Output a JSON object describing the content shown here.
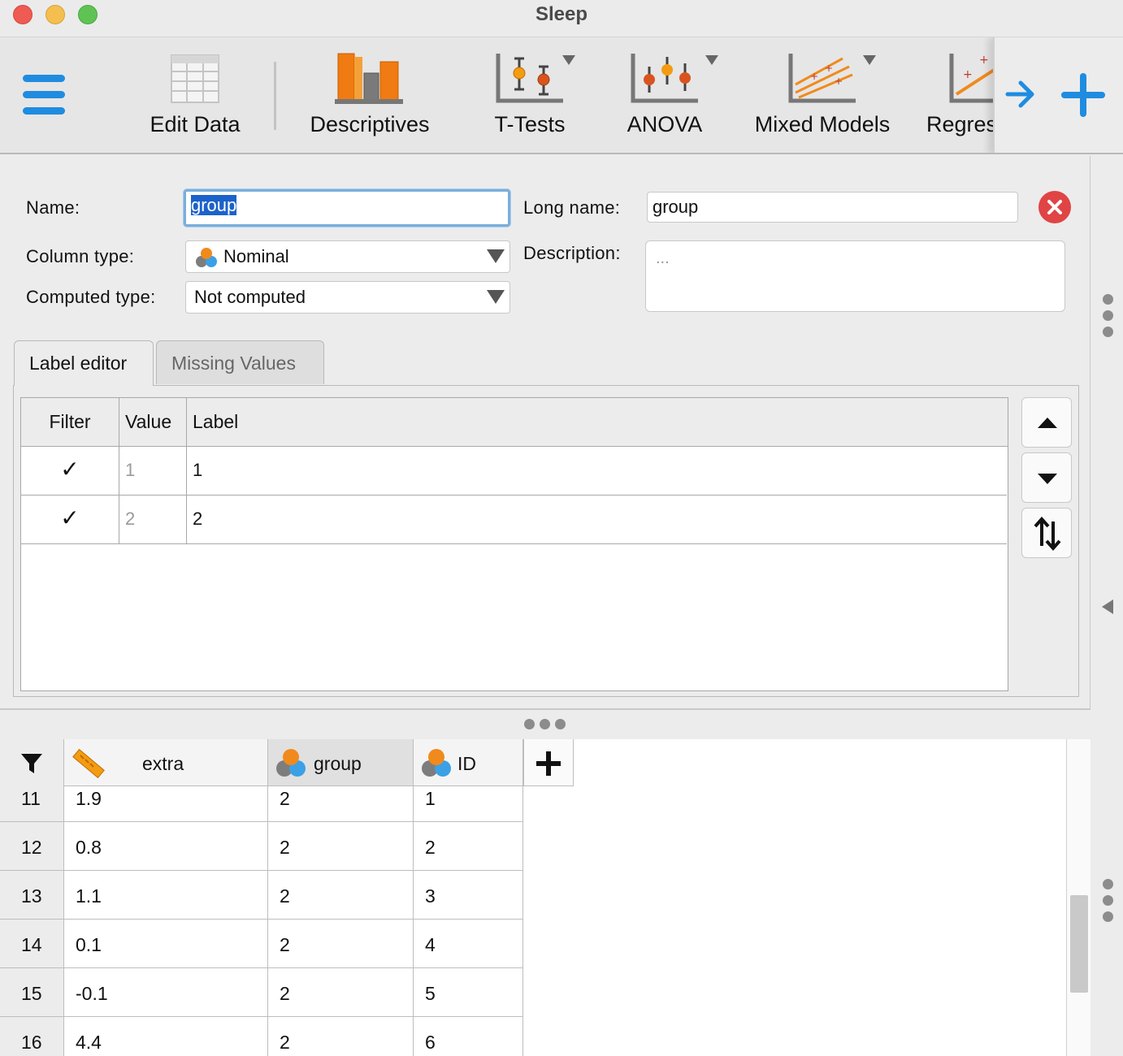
{
  "window": {
    "title": "Sleep"
  },
  "ribbon": {
    "buttons": [
      {
        "label": "Edit Data",
        "icon": "edit-data-icon"
      },
      {
        "label": "Descriptives",
        "icon": "descriptives-icon"
      },
      {
        "label": "T-Tests",
        "icon": "t-tests-icon",
        "has_dropdown": true
      },
      {
        "label": "ANOVA",
        "icon": "anova-icon",
        "has_dropdown": true
      },
      {
        "label": "Mixed Models",
        "icon": "mixed-models-icon",
        "has_dropdown": true
      },
      {
        "label": "Regres",
        "icon": "regression-icon"
      }
    ],
    "accent_color": "#1f8ce0"
  },
  "editor": {
    "name_label": "Name:",
    "name_value": "group",
    "long_name_label": "Long name:",
    "long_name_value": "group",
    "column_type_label": "Column type:",
    "column_type_value": "Nominal",
    "computed_type_label": "Computed type:",
    "computed_type_value": "Not computed",
    "description_label": "Description:",
    "description_placeholder": "...",
    "tabs": [
      "Label editor",
      "Missing Values"
    ],
    "active_tab": "Label editor",
    "labels_table": {
      "headers": [
        "Filter",
        "Value",
        "Label"
      ],
      "rows": [
        {
          "filter": "✓",
          "value": "1",
          "label": "1"
        },
        {
          "filter": "✓",
          "value": "2",
          "label": "2"
        }
      ]
    }
  },
  "grid": {
    "columns": [
      {
        "name": "extra",
        "type_icon": "scale-ruler-icon"
      },
      {
        "name": "group",
        "type_icon": "nominal-icon"
      },
      {
        "name": "ID",
        "type_icon": "nominal-icon"
      }
    ],
    "rows": [
      {
        "n": "11",
        "extra": "1.9",
        "group": "2",
        "id": "1"
      },
      {
        "n": "12",
        "extra": "0.8",
        "group": "2",
        "id": "2"
      },
      {
        "n": "13",
        "extra": "1.1",
        "group": "2",
        "id": "3"
      },
      {
        "n": "14",
        "extra": "0.1",
        "group": "2",
        "id": "4"
      },
      {
        "n": "15",
        "extra": "-0.1",
        "group": "2",
        "id": "5"
      },
      {
        "n": "16",
        "extra": "4.4",
        "group": "2",
        "id": "6"
      }
    ]
  }
}
